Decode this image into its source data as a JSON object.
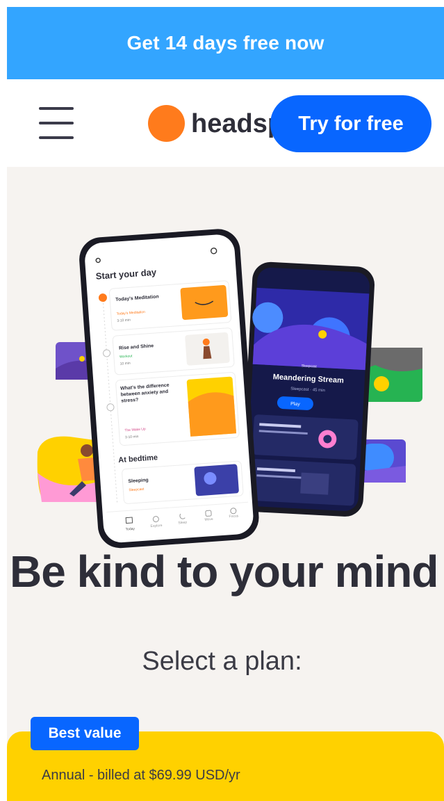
{
  "banner": {
    "text": "Get 14 days free now"
  },
  "nav": {
    "logo_text": "headspace",
    "cta_label": "Try for free"
  },
  "phone_left": {
    "heading": "Start your day",
    "items": [
      {
        "title": "Today's Meditation",
        "tag": "Today's Meditation",
        "time": "3-10 min"
      },
      {
        "title": "Rise and Shine",
        "tag": "Workout",
        "time": "10 min"
      },
      {
        "title": "What's the difference between anxiety and stress?",
        "tag": "The Wake Up",
        "time": "3-10 min"
      }
    ],
    "section2": "At bedtime",
    "item4": {
      "title": "Sleeping",
      "tag": "Sleepcast"
    },
    "tabs": [
      "Today",
      "Explore",
      "Sleep",
      "Move",
      "Focus"
    ]
  },
  "phone_right": {
    "chip": "Sleepcast",
    "title": "Meandering Stream",
    "meta": "Sleepcast · 45 min",
    "play": "Play"
  },
  "hero": {
    "headline": "Be kind to your mind"
  },
  "plans": {
    "heading": "Select a plan:",
    "badge": "Best value",
    "annual": "Annual - billed at $69.99 USD/yr"
  },
  "colors": {
    "banner": "#33a5ff",
    "cta": "#0866ff",
    "logo": "#ff7b1c",
    "hero_bg": "#f6f3f0",
    "plan_card": "#ffd100",
    "badge": "#0866ff"
  }
}
